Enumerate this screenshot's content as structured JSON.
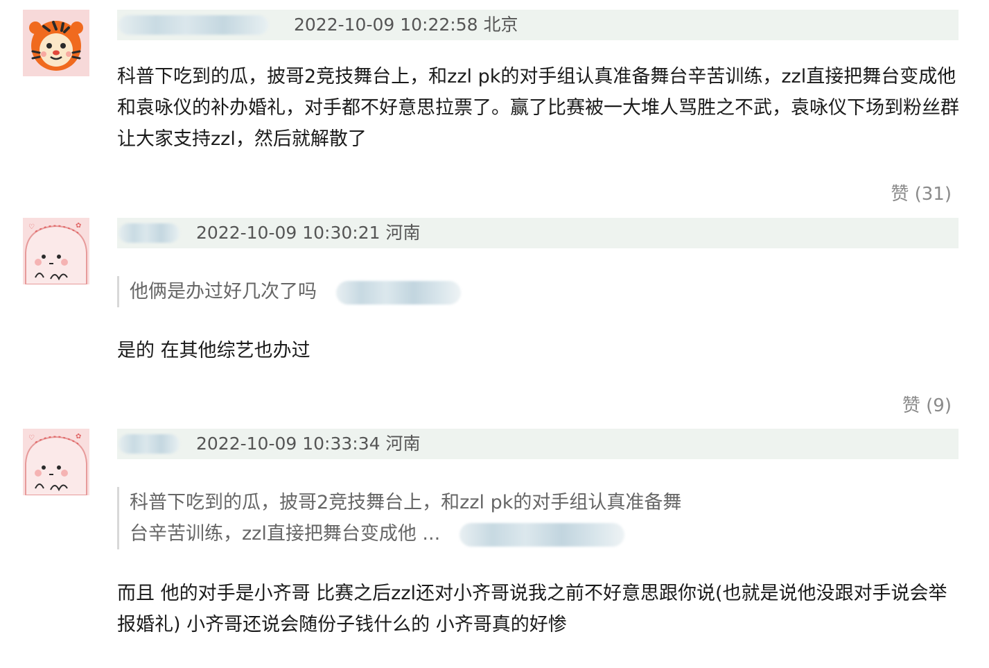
{
  "comments": [
    {
      "timestamp": "2022-10-09 10:22:58",
      "location": "北京",
      "avatar": "tiger-avatar-icon",
      "text": "科普下吃到的瓜，披哥2竞技舞台上，和zzl pk的对手组认真准备舞台辛苦训练，zzl直接把舞台变成他和袁咏仪的补办婚礼，对手都不好意思拉票了。赢了比赛被一大堆人骂胜之不武，袁咏仪下场到粉丝群让大家支持zzl，然后就解散了",
      "like_label": "赞 (31)"
    },
    {
      "timestamp": "2022-10-09 10:30:21",
      "location": "河南",
      "avatar": "pink-ghost-avatar-icon",
      "quote": [
        "他俩是办过好几次了吗"
      ],
      "text": "是的 在其他综艺也办过",
      "like_label": "赞 (9)"
    },
    {
      "timestamp": "2022-10-09 10:33:34",
      "location": "河南",
      "avatar": "pink-ghost-avatar-icon",
      "quote": [
        "科普下吃到的瓜，披哥2竞技舞台上，和zzl pk的对手组认真准备舞",
        "台辛苦训练，zzl直接把舞台变成他 ..."
      ],
      "text": "而且 他的对手是小齐哥 比赛之后zzl还对小齐哥说我之前不好意思跟你说(也就是说他没跟对手说会举报婚礼) 小齐哥还说会随份子钱什么的 小齐哥真的好惨"
    }
  ],
  "colors": {
    "meta_bar": "#eef3ef",
    "meta_text": "#555555",
    "body_text": "#1a1a1a",
    "quote_text": "#666666",
    "like_text": "#8a8a8a"
  }
}
